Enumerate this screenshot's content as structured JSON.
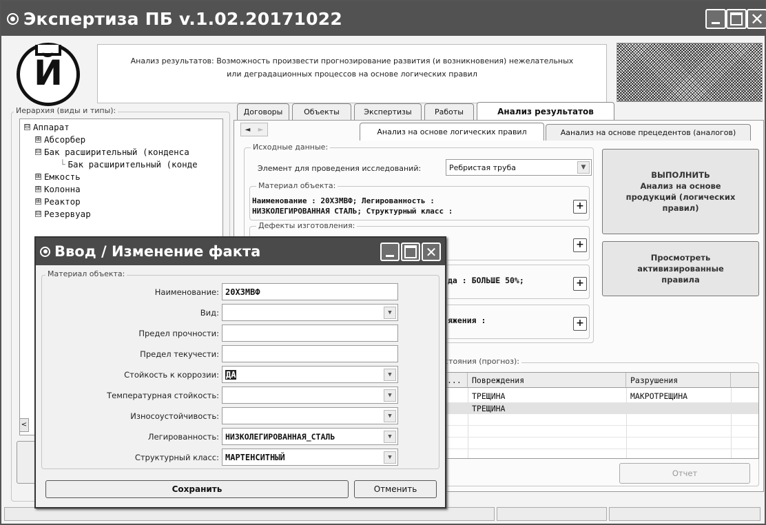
{
  "window": {
    "title": "Экспертиза ПБ v.1.02.20171022"
  },
  "header": {
    "description_line1": "Анализ результатов: Возможность произвести прогнозирование развития (и возникновения) нежелательных",
    "description_line2": "или деградационных процессов на основе логических правил",
    "logo_letter": "Й"
  },
  "hierarchy": {
    "label": "Иерархия (виды и типы):",
    "items": [
      {
        "label": "Аппарат",
        "toggle": "⊟"
      },
      {
        "label": "Абсорбер",
        "toggle": "⊞"
      },
      {
        "label": "Бак расширительный (конденса",
        "toggle": "⊟"
      },
      {
        "label": "Бак расширительный (конде",
        "toggle": ""
      },
      {
        "label": "Емкость",
        "toggle": "⊞"
      },
      {
        "label": "Колонна",
        "toggle": "⊞"
      },
      {
        "label": "Реактор",
        "toggle": "⊞"
      },
      {
        "label": "Резервуар",
        "toggle": "⊟"
      }
    ],
    "scroll_left": "<"
  },
  "tabs": [
    {
      "label": "Договоры"
    },
    {
      "label": "Объекты"
    },
    {
      "label": "Экспертизы"
    },
    {
      "label": "Работы"
    },
    {
      "label": "Анализ результатов"
    }
  ],
  "subtabs": [
    {
      "label": "Анализ на основе логических правил"
    },
    {
      "label": "Аанализ на основе прецедентов (аналогов)"
    }
  ],
  "nav": {
    "left": "◄",
    "right": "►"
  },
  "source": {
    "label": "Исходные данные:",
    "element_label": "Элемент для проведения исследований:",
    "element_value": "Ребристая труба",
    "material_label": "Материал объекта:",
    "material_text1": "Наименование : 20Х3МВФ; Легированность :",
    "material_text2": "НИЗКОЛЕГИРОВАННАЯ СТАЛЬ; Структурный класс :",
    "defects_label": "Дефекты изготовления:",
    "defects_text": "",
    "group3_text": "да : БОЛЬШЕ 50%;",
    "group4_text": "яжения :",
    "plus": "+"
  },
  "actions": {
    "run_label": "ВЫПОЛНИТЬ\nАнализ на основе\nпродукций (логических\nправил)",
    "view_label": "Просмотреть\nактивизированные\nправила"
  },
  "forecast": {
    "label": "стояния (прогноз):",
    "columns": [
      "...",
      "Повреждения",
      "Разрушения"
    ],
    "rows": [
      [
        "",
        "ТРЕЩИНА",
        "МАКРОТРЕЩИНА"
      ],
      [
        "",
        "ТРЕЩИНА",
        ""
      ]
    ],
    "report_button": "Отчет"
  },
  "dialog": {
    "title": "Ввод / Изменение факта",
    "group_label": "Материал объекта:",
    "fields": [
      {
        "label": "Наименование:",
        "value": "20Х3МВФ"
      },
      {
        "label": "Вид:",
        "value": ""
      },
      {
        "label": "Предел прочности:",
        "value": ""
      },
      {
        "label": "Предел текучести:",
        "value": ""
      },
      {
        "label": "Стойкость к коррозии:",
        "value": "ДА"
      },
      {
        "label": "Температурная стойкость:",
        "value": ""
      },
      {
        "label": "Износоустойчивость:",
        "value": ""
      },
      {
        "label": "Легированность:",
        "value": "НИЗКОЛЕГИРОВАННАЯ_СТАЛЬ"
      },
      {
        "label": "Структурный класс:",
        "value": "МАРТЕНСИТНЫЙ"
      }
    ],
    "save": "Сохранить",
    "cancel": "Отменить"
  }
}
